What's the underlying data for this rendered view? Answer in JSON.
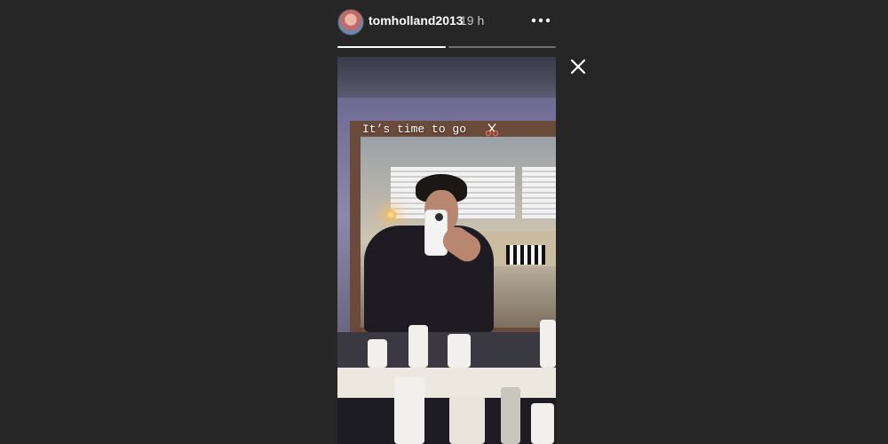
{
  "story": {
    "user": {
      "username": "tomholland2013",
      "avatar_icon": "avatar"
    },
    "timestamp": "19 h",
    "progress": [
      {
        "segment": 1,
        "fill": 1.0
      },
      {
        "segment": 2,
        "fill": 0.0
      }
    ],
    "caption_text": "It’s time to go",
    "caption_emoji": "scissors",
    "icons": {
      "more": "more-options-icon",
      "close": "close-icon",
      "scissors": "scissors-icon"
    },
    "colors": {
      "background": "#262626",
      "text": "#ffffff",
      "muted": "#c8c8c8"
    }
  }
}
